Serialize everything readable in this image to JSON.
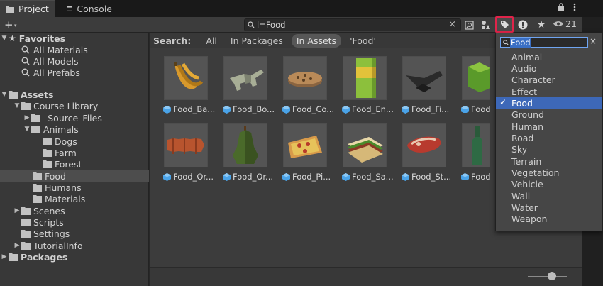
{
  "tabs": [
    {
      "label": "Project",
      "active": true,
      "icon": "folder-icon"
    },
    {
      "label": "Console",
      "active": false,
      "icon": "console-icon"
    }
  ],
  "window_controls": {
    "lock": "lock-icon",
    "menu": "kebab-menu-icon"
  },
  "toolbar": {
    "add_label": "+",
    "search_value": "l=Food",
    "clear_glyph": "×",
    "hidden_count": "21",
    "buttons": [
      "search-by-type-icon",
      "search-by-label-icon",
      "warning-icon",
      "favorite-star-icon",
      "visibility-eye-icon"
    ]
  },
  "tree": {
    "favorites_label": "Favorites",
    "favorites": [
      "All Materials",
      "All Models",
      "All Prefabs"
    ],
    "assets_label": "Assets",
    "course_library": "Course Library",
    "source_files": "_Source_Files",
    "animals": "Animals",
    "dogs": "Dogs",
    "farm": "Farm",
    "forest": "Forest",
    "food": "Food",
    "humans": "Humans",
    "materials": "Materials",
    "scenes": "Scenes",
    "scripts": "Scripts",
    "settings": "Settings",
    "tutorialinfo": "TutorialInfo",
    "packages": "Packages"
  },
  "search_filter": {
    "label": "Search:",
    "options": [
      "All",
      "In Packages",
      "In Assets",
      "'Food'"
    ],
    "active": "In Assets"
  },
  "assets": [
    {
      "name": "Food_Ba...",
      "thumb": "banana"
    },
    {
      "name": "Food_Bo...",
      "thumb": "bone"
    },
    {
      "name": "Food_Co...",
      "thumb": "cookie"
    },
    {
      "name": "Food_En...",
      "thumb": "energy-drink"
    },
    {
      "name": "Food_Fi...",
      "thumb": "fish"
    },
    {
      "name": "Food_C...",
      "thumb": "cheese"
    },
    {
      "name": "Food_Or...",
      "thumb": "orange-slices"
    },
    {
      "name": "Food_Or...",
      "thumb": "pear"
    },
    {
      "name": "Food_Pi...",
      "thumb": "pizza"
    },
    {
      "name": "Food_Sa...",
      "thumb": "sandwich"
    },
    {
      "name": "Food_St...",
      "thumb": "steak"
    },
    {
      "name": "Food_V...",
      "thumb": "wine-bottle"
    }
  ],
  "label_dropdown": {
    "search_value": "Food",
    "close_glyph": "×",
    "selected": "Food",
    "check": "✓",
    "items": [
      "Animal",
      "Audio",
      "Character",
      "Effect",
      "Food",
      "Ground",
      "Human",
      "Road",
      "Sky",
      "Terrain",
      "Vegetation",
      "Vehicle",
      "Wall",
      "Water",
      "Weapon"
    ]
  },
  "colors": {
    "highlight_border": "#e0244a",
    "selection": "#3d68b8",
    "asset_icon": "#4aa3e8"
  }
}
